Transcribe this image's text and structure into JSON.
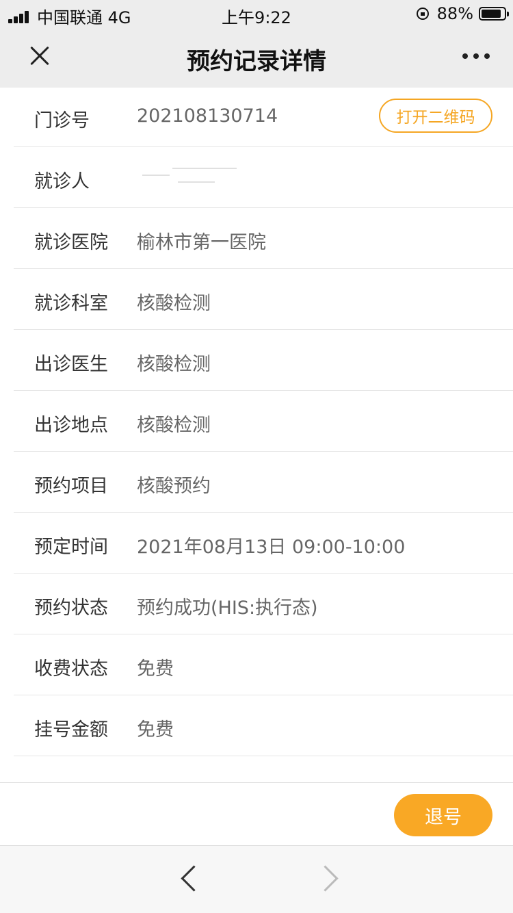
{
  "status_bar": {
    "carrier": "中国联通 4G",
    "time": "上午9:22",
    "battery": "88%",
    "battery_level": 0.88
  },
  "nav": {
    "title": "预约记录详情"
  },
  "rows": [
    {
      "label": "门诊号",
      "value": "202108130714"
    },
    {
      "label": "就诊人",
      "value": ""
    },
    {
      "label": "就诊医院",
      "value": "榆林市第一医院"
    },
    {
      "label": "就诊科室",
      "value": "核酸检测"
    },
    {
      "label": "出诊医生",
      "value": "核酸检测"
    },
    {
      "label": "出诊地点",
      "value": "核酸检测"
    },
    {
      "label": "预约项目",
      "value": "核酸预约"
    },
    {
      "label": "预定时间",
      "value": "2021年08月13日  09:00-10:00"
    },
    {
      "label": "预约状态",
      "value": "预约成功(HIS:执行态)"
    },
    {
      "label": "收费状态",
      "value": "免费"
    },
    {
      "label": "挂号金额",
      "value": "免费"
    }
  ],
  "qr_button_label": "打开二维码",
  "refund_button_label": "退号",
  "colors": {
    "accent": "#f5a623",
    "refund_bg": "#f9a825",
    "header_bg": "#ededed"
  },
  "icons": {
    "close": "close-icon",
    "more": "more-icon",
    "back": "chevron-left-icon",
    "forward": "chevron-right-icon"
  }
}
